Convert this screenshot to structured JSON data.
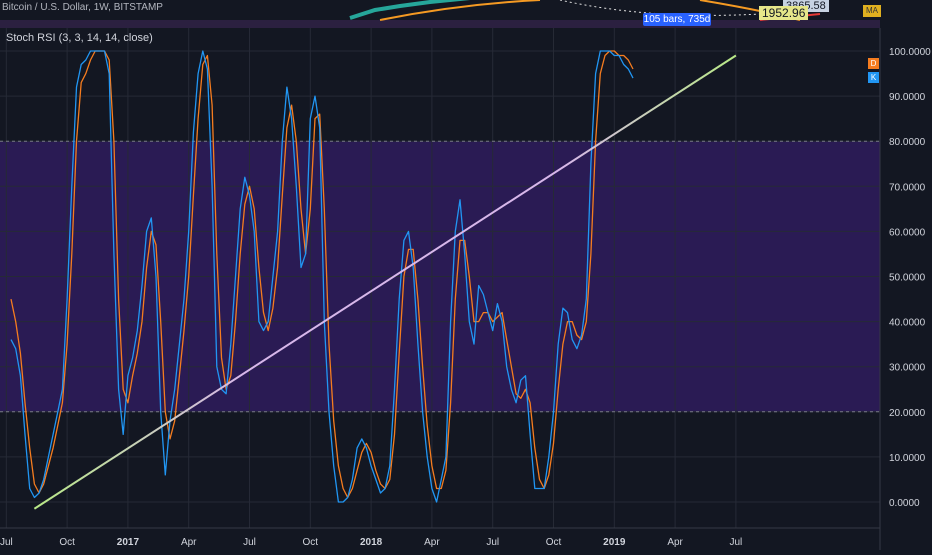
{
  "header": {
    "symbol_title": "Bitcoin / U.S. Dollar, 1W, BITSTAMP",
    "bars_badge": "105 bars, 735d",
    "price_a": "3865.58",
    "price_b": "1952.96",
    "ma_label": "MA"
  },
  "indicator": {
    "title": "Stoch RSI (3, 3, 14, 14, close)"
  },
  "legend": {
    "d_label": "D",
    "k_label": "K"
  },
  "colors": {
    "background": "#131722",
    "band_fill": "#2a1b54",
    "k_line": "#2196f3",
    "d_line": "#f57c1f",
    "trendline_start": "#b8e986",
    "trendline_end": "#d7b7ea",
    "axis_text": "#d1d4dc",
    "grid": "#262a36"
  },
  "chart_data": {
    "type": "line",
    "y_ticks": [
      "100.0000",
      "90.0000",
      "80.0000",
      "70.0000",
      "60.0000",
      "50.0000",
      "40.0000",
      "30.0000",
      "20.0000",
      "10.0000",
      "0.0000"
    ],
    "ylim": [
      -3,
      102
    ],
    "band": [
      20,
      80
    ],
    "x_ticks": [
      "Jul",
      "Oct",
      "2017",
      "Apr",
      "Jul",
      "Oct",
      "2018",
      "Apr",
      "Jul",
      "Oct",
      "2019",
      "Apr",
      "Jul"
    ],
    "x_tick_pos": [
      0,
      13,
      26,
      39,
      52,
      65,
      78,
      91,
      104,
      117,
      130,
      143,
      156
    ],
    "xlim": [
      1,
      165
    ],
    "series": [
      {
        "name": "K",
        "values": [
          36,
          34,
          28,
          15,
          3,
          1,
          2,
          5,
          10,
          15,
          20,
          25,
          45,
          70,
          92,
          97,
          98,
          100,
          100,
          100,
          100,
          95,
          55,
          25,
          15,
          28,
          32,
          38,
          48,
          60,
          63,
          50,
          20,
          6,
          18,
          25,
          35,
          45,
          60,
          82,
          95,
          100,
          96,
          70,
          30,
          25,
          24,
          35,
          50,
          65,
          72,
          68,
          60,
          40,
          38,
          40,
          50,
          60,
          80,
          92,
          85,
          70,
          52,
          55,
          85,
          90,
          83,
          40,
          20,
          8,
          0,
          0,
          1,
          5,
          12,
          14,
          12,
          8,
          5,
          2,
          3,
          8,
          25,
          45,
          58,
          60,
          52,
          35,
          20,
          10,
          3,
          0,
          5,
          10,
          40,
          60,
          67,
          55,
          40,
          35,
          48,
          46,
          42,
          38,
          44,
          40,
          30,
          25,
          22,
          27,
          28,
          15,
          3,
          3,
          3,
          10,
          20,
          35,
          43,
          42,
          36,
          34,
          37,
          45,
          75,
          95,
          100,
          100,
          100,
          99,
          99,
          97,
          96,
          94
        ]
      },
      {
        "name": "D",
        "values": [
          45,
          40,
          33,
          22,
          12,
          4,
          2,
          4,
          8,
          12,
          17,
          22,
          35,
          55,
          80,
          93,
          95,
          98,
          100,
          100,
          100,
          98,
          80,
          45,
          25,
          22,
          28,
          33,
          40,
          52,
          60,
          57,
          40,
          20,
          14,
          18,
          28,
          38,
          50,
          68,
          85,
          97,
          99,
          88,
          55,
          32,
          25,
          28,
          40,
          55,
          66,
          70,
          65,
          52,
          42,
          38,
          43,
          52,
          68,
          83,
          88,
          80,
          65,
          55,
          65,
          85,
          86,
          65,
          35,
          18,
          8,
          3,
          1,
          3,
          7,
          11,
          13,
          11,
          7,
          4,
          3,
          5,
          15,
          33,
          50,
          56,
          56,
          45,
          30,
          17,
          8,
          3,
          3,
          7,
          22,
          45,
          58,
          58,
          50,
          40,
          40,
          42,
          42,
          40,
          41,
          42,
          36,
          30,
          24,
          23,
          25,
          22,
          12,
          5,
          3,
          6,
          13,
          25,
          35,
          40,
          40,
          37,
          36,
          40,
          55,
          80,
          95,
          99,
          100,
          100,
          99,
          99,
          98,
          96
        ]
      }
    ],
    "trendline": {
      "x": [
        6,
        156
      ],
      "y": [
        -1.5,
        99
      ]
    }
  }
}
